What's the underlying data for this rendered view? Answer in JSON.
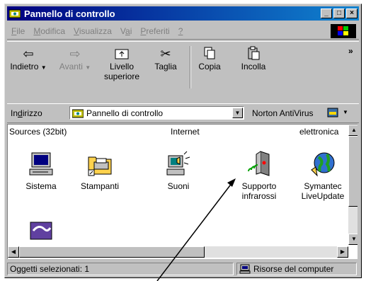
{
  "window": {
    "title": "Pannello di controllo"
  },
  "menu": [
    {
      "label": "File",
      "key": "F",
      "rest": "ile"
    },
    {
      "label": "Modifica",
      "key": "M",
      "rest": "odifica"
    },
    {
      "label": "Visualizza",
      "key": "V",
      "rest": "isualizza"
    },
    {
      "label": "Vai",
      "pre": "V",
      "key": "a",
      "rest": "i"
    },
    {
      "label": "Preferiti",
      "key": "P",
      "rest": "referiti"
    },
    {
      "label": "?",
      "key": "?",
      "rest": ""
    }
  ],
  "toolbar": {
    "back": "Indietro",
    "forward": "Avanti",
    "up_line1": "Livello",
    "up_line2": "superiore",
    "cut": "Taglia",
    "copy": "Copia",
    "paste": "Incolla",
    "more": "»"
  },
  "address": {
    "label_pre": "In",
    "label_key": "d",
    "label_post": "irizzo",
    "value": "Pannello di controllo",
    "norton": "Norton AntiVirus"
  },
  "content": {
    "headers": [
      "Sources (32bit)",
      "Internet",
      "elettronica"
    ],
    "items": [
      {
        "name": "Sistema",
        "line2": ""
      },
      {
        "name": "Stampanti",
        "line2": ""
      },
      {
        "name": "Suoni",
        "line2": ""
      },
      {
        "name": "Supporto",
        "line2": "infrarossi"
      },
      {
        "name": "Symantec",
        "line2": "LiveUpdate"
      }
    ]
  },
  "status": {
    "selected": "Oggetti selezionati: 1",
    "location": "Risorse del computer"
  },
  "colors": {
    "titlebar": "#000080",
    "face": "#c0c0c0"
  }
}
